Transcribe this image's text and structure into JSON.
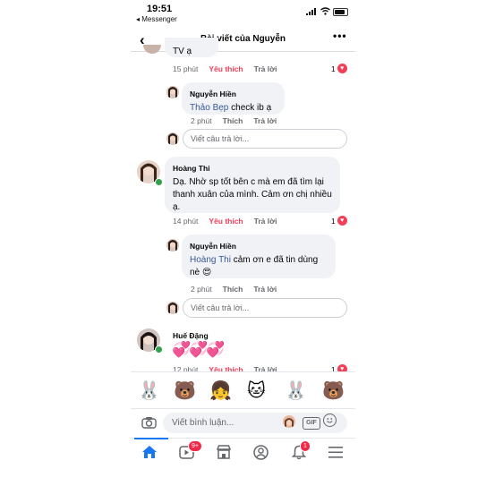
{
  "status": {
    "time": "19:51",
    "back_app": "◂ Messenger"
  },
  "header": {
    "title": "Bài viết của Nguyễn"
  },
  "top_cut": {
    "text": "TV ạ",
    "time": "15 phút",
    "like": "Yêu thích",
    "reply": "Trả lời",
    "reactions": "1"
  },
  "reply1": {
    "author": "Nguyễn Hiền",
    "mention": "Thảo Bẹp",
    "text": " check ib ạ",
    "time": "2 phút",
    "like": "Thích",
    "reply": "Trả lời"
  },
  "reply_box1": {
    "placeholder": "Viết câu trả lời..."
  },
  "comment2": {
    "author": "Hoàng Thi",
    "text": "Dạ. Nhờ sp tốt bên c mà em đã tìm lại thanh xuân của mình. Cảm ơn chị nhiều ạ.",
    "time": "14 phút",
    "like": "Yêu thích",
    "reply": "Trả lời",
    "reactions": "1"
  },
  "reply2": {
    "author": "Nguyễn Hiền",
    "mention": "Hoàng Thi",
    "text": " cảm ơn e đã tin dùng nè 😍",
    "time": "2 phút",
    "like": "Thích",
    "reply": "Trả lời"
  },
  "reply_box2": {
    "placeholder": "Viết câu trả lời..."
  },
  "comment3": {
    "author": "Huế Đặng",
    "hearts": "💞💞💞",
    "time": "12 phút",
    "like": "Yêu thích",
    "reply": "Trả lời",
    "reactions": "1"
  },
  "stickers": [
    "🐰",
    "🐻",
    "👧",
    "🐱",
    "🐰",
    "🐻"
  ],
  "composer": {
    "placeholder": "Viết bình luận...",
    "gif": "GIF"
  },
  "nav": {
    "video_badge": "9+",
    "notif_badge": "1"
  },
  "colors": {
    "accent": "#1877f2",
    "like": "#f33e58",
    "mention": "#385898"
  },
  "icons": [
    "camera-icon",
    "home-icon",
    "video-icon",
    "marketplace-icon",
    "profile-icon",
    "bell-icon",
    "menu-icon",
    "heart-icon",
    "gif-icon",
    "emoji-icon"
  ]
}
